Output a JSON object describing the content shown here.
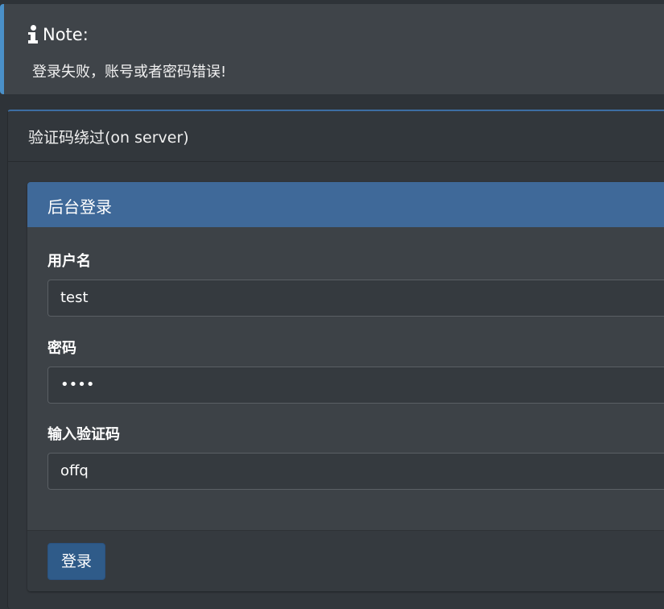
{
  "note": {
    "title": "Note:",
    "message": "登录失败，账号或者密码错误!"
  },
  "card": {
    "title": "验证码绕过(on server)"
  },
  "login_panel": {
    "title": "后台登录",
    "username_label": "用户名",
    "username_value": "test",
    "password_label": "密码",
    "password_value": "••••",
    "captcha_label": "输入验证码",
    "captcha_value": "offq",
    "submit_label": "登录"
  },
  "colors": {
    "background": "#2e3338",
    "note_border": "#4a90c8",
    "panel_header": "#3f6999",
    "button": "#2f5b89"
  }
}
